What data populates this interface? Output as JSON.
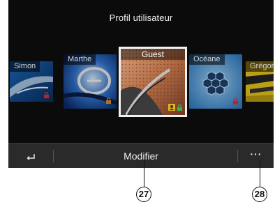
{
  "screen": {
    "title": "Profil utilisateur"
  },
  "profiles": [
    {
      "name": "Simon",
      "selected": false,
      "locked": true,
      "lock_color": "#e03030"
    },
    {
      "name": "Marthe",
      "selected": false,
      "locked": true,
      "lock_color": "#e08a20"
    },
    {
      "name": "Guest",
      "selected": true,
      "locked": true,
      "lock_color": "#39b54a"
    },
    {
      "name": "Océane",
      "selected": false,
      "locked": true,
      "lock_color": "#e03030"
    },
    {
      "name": "Grégory",
      "selected": false,
      "locked": false,
      "lock_color": ""
    }
  ],
  "bottom_bar": {
    "back_icon": "back-arrow-icon",
    "modify_label": "Modifier",
    "more_label": "···"
  },
  "callouts": {
    "modify": "27",
    "more": "28"
  }
}
